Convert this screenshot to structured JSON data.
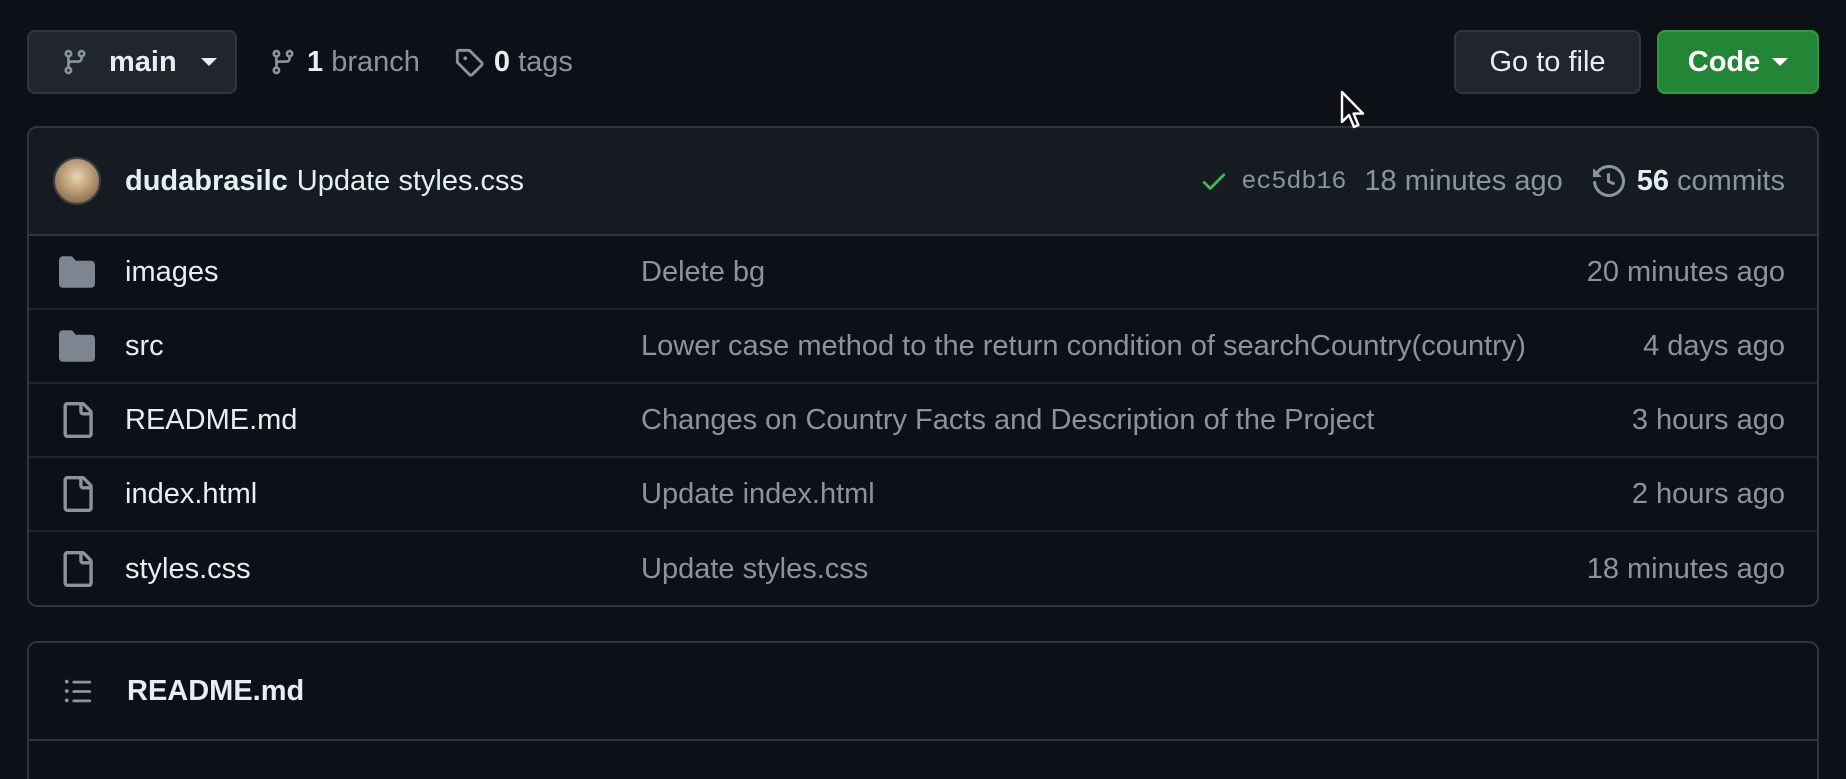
{
  "topbar": {
    "branch_name": "main",
    "branch_count": "1",
    "branch_label": "branch",
    "tag_count": "0",
    "tag_label": "tags",
    "go_to_file_label": "Go to file",
    "code_label": "Code"
  },
  "latest_commit": {
    "author": "dudabrasilc",
    "message": "Update styles.css",
    "sha": "ec5db16",
    "time": "18 minutes ago",
    "commit_count": "56",
    "commit_label": "commits",
    "status_icon": "check-icon"
  },
  "files": [
    {
      "type": "folder",
      "icon": "folder-icon",
      "name": "images",
      "message": "Delete bg",
      "age": "20 minutes ago"
    },
    {
      "type": "folder",
      "icon": "folder-icon",
      "name": "src",
      "message": "Lower case method to the return condition of searchCountry(country)",
      "age": "4 days ago"
    },
    {
      "type": "file",
      "icon": "file-icon",
      "name": "README.md",
      "message": "Changes on Country Facts and Description of the Project",
      "age": "3 hours ago"
    },
    {
      "type": "file",
      "icon": "file-icon",
      "name": "index.html",
      "message": "Update index.html",
      "age": "2 hours ago"
    },
    {
      "type": "file",
      "icon": "file-icon",
      "name": "styles.css",
      "message": "Update styles.css",
      "age": "18 minutes ago"
    }
  ],
  "readme": {
    "title": "README.md",
    "icon": "list-icon"
  },
  "colors": {
    "background": "#0d1117",
    "surface": "#161b22",
    "border": "#30363d",
    "accent_green": "#238636",
    "muted_text": "#8b949e",
    "folder_icon": "#7d8590"
  }
}
